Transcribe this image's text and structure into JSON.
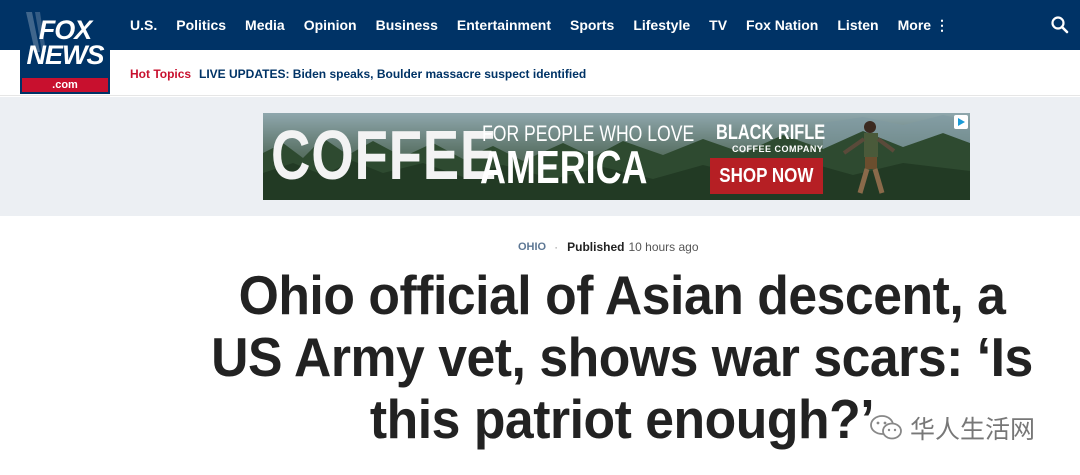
{
  "logo": {
    "word1": "FOX",
    "word2": "NEWS",
    "domain": ".com"
  },
  "nav": {
    "items": [
      "U.S.",
      "Politics",
      "Media",
      "Opinion",
      "Business",
      "Entertainment",
      "Sports",
      "Lifestyle",
      "TV",
      "Fox Nation",
      "Listen",
      "More ⋮"
    ]
  },
  "hot_topics": {
    "label": "Hot Topics",
    "link": "LIVE UPDATES: Biden speaks, Boulder massacre suspect identified"
  },
  "ad": {
    "headline": "COFFEE",
    "tagline_top": "FOR PEOPLE WHO LOVE",
    "tagline_bottom": "AMERICA",
    "brand": "BLACK RIFLE",
    "brand_sub": "COFFEE COMPANY",
    "cta": "SHOP NOW"
  },
  "article": {
    "category": "OHIO",
    "published_label": "Published",
    "published_time": "10 hours ago",
    "headline": "Ohio official of Asian descent, a US Army vet, shows war scars: ‘Is this patriot enough?’"
  },
  "watermark": {
    "text": "华人生活网"
  },
  "colors": {
    "navy": "#003366",
    "red": "#c8102e",
    "ad_button": "#b61f24",
    "text": "#222222"
  }
}
